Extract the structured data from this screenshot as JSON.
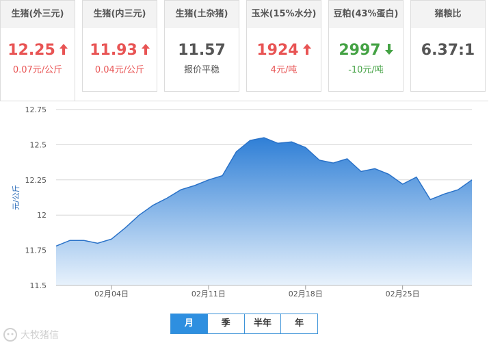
{
  "cards": [
    {
      "title": "生猪(外三元)",
      "value": "12.25",
      "trend": "up",
      "change": "0.07",
      "unit": "元/公斤"
    },
    {
      "title": "生猪(内三元)",
      "value": "11.93",
      "trend": "up",
      "change": "0.04",
      "unit": "元/公斤"
    },
    {
      "title": "生猪(土杂猪)",
      "value": "11.57",
      "trend": "flat",
      "change": "",
      "unit": "报价平稳"
    },
    {
      "title": "玉米(15%水分)",
      "value": "1924",
      "trend": "up",
      "change": "4",
      "unit": "元/吨"
    },
    {
      "title": "豆粕(43%蛋白)",
      "value": "2997",
      "trend": "down",
      "change": "-10",
      "unit": "元/吨"
    },
    {
      "title": "猪粮比",
      "value": "6.37:1",
      "trend": "none",
      "change": "",
      "unit": ""
    }
  ],
  "colors": {
    "up": "#e85454",
    "down": "#44a244",
    "accent": "#2e8fe0",
    "area_top": "#2f7fd6",
    "area_bottom": "#e8f2fc"
  },
  "chart_data": {
    "type": "area",
    "ylabel": "元/公斤",
    "ylim": [
      11.5,
      12.75
    ],
    "yticks": [
      "11.5",
      "11.75",
      "12",
      "12.25",
      "12.5",
      "12.75"
    ],
    "grid": true,
    "x": [
      "01-31",
      "02-01",
      "02-02",
      "02-03",
      "02-04",
      "02-05",
      "02-06",
      "02-07",
      "02-08",
      "02-09",
      "02-10",
      "02-11",
      "02-12",
      "02-13",
      "02-14",
      "02-15",
      "02-16",
      "02-17",
      "02-18",
      "02-19",
      "02-20",
      "02-21",
      "02-22",
      "02-23",
      "02-24",
      "02-25",
      "02-26",
      "02-27",
      "02-28",
      "02-29",
      "03-01"
    ],
    "xtick_labels": [
      {
        "x": "02-04",
        "label": "02月04日"
      },
      {
        "x": "02-11",
        "label": "02月11日"
      },
      {
        "x": "02-18",
        "label": "02月18日"
      },
      {
        "x": "02-25",
        "label": "02月25日"
      }
    ],
    "values": [
      11.78,
      11.82,
      11.82,
      11.8,
      11.83,
      11.91,
      12.0,
      12.07,
      12.12,
      12.18,
      12.21,
      12.25,
      12.28,
      12.45,
      12.53,
      12.55,
      12.51,
      12.52,
      12.48,
      12.39,
      12.37,
      12.4,
      12.31,
      12.33,
      12.29,
      12.22,
      12.27,
      12.11,
      12.15,
      12.18,
      12.25
    ]
  },
  "tabs": [
    {
      "label": "月",
      "active": true
    },
    {
      "label": "季",
      "active": false
    },
    {
      "label": "半年",
      "active": false
    },
    {
      "label": "年",
      "active": false
    }
  ],
  "watermark": {
    "text": "大牧猪信"
  }
}
